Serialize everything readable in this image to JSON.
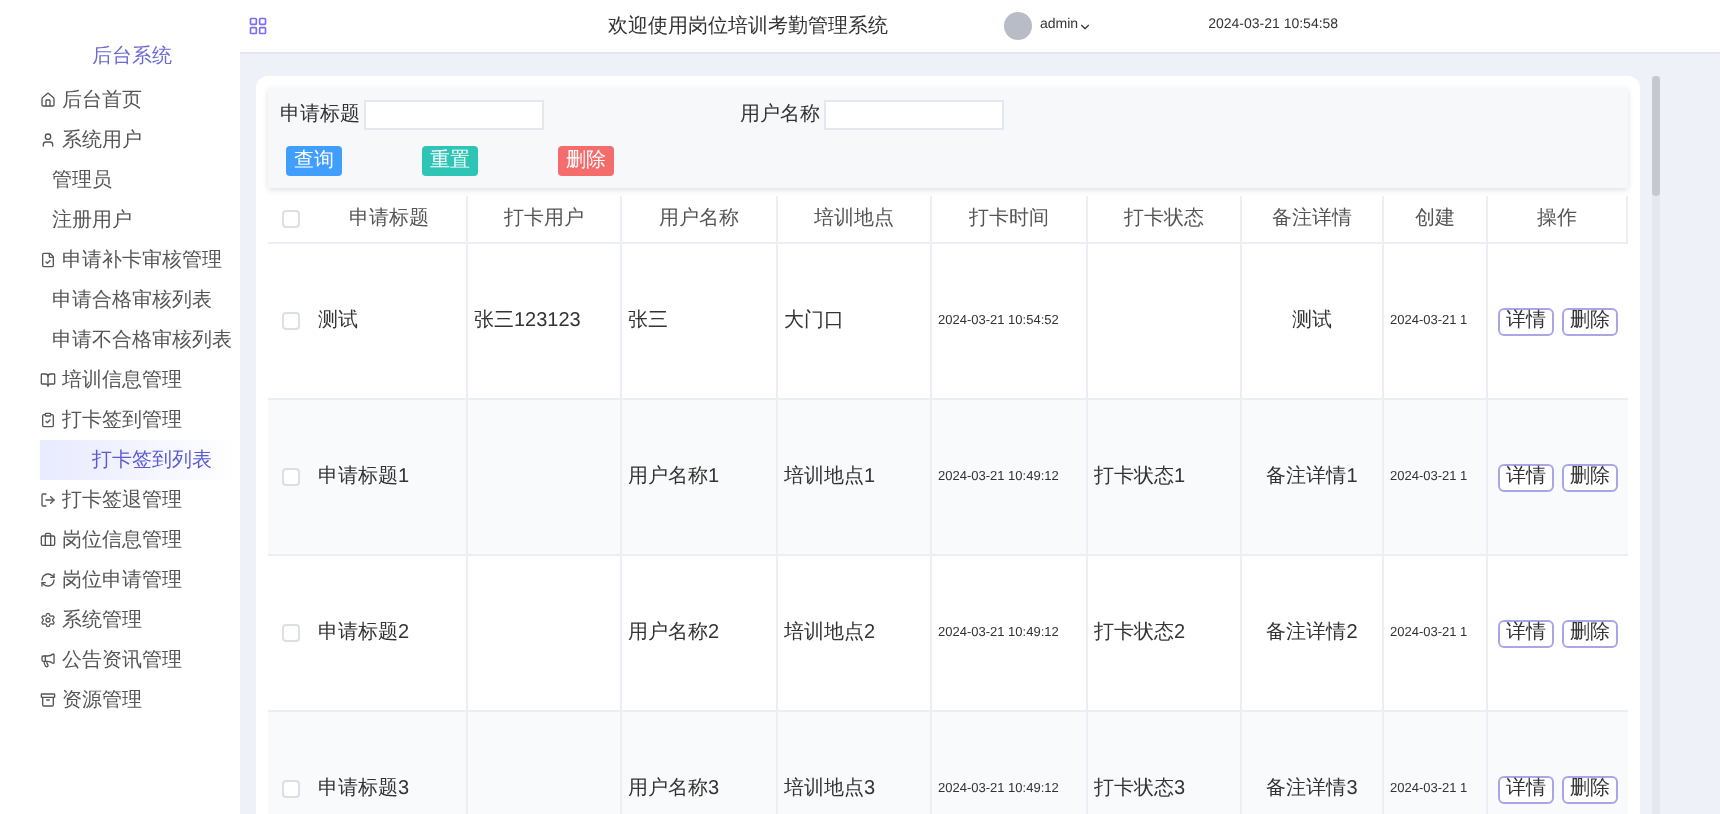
{
  "sidebar": {
    "title": "后台系统",
    "items": [
      {
        "label": "后台首页",
        "selected": false
      },
      {
        "label": "系统用户",
        "selected": false,
        "children": [
          {
            "label": "管理员",
            "selected": false
          },
          {
            "label": "注册用户",
            "selected": false
          }
        ]
      },
      {
        "label": "申请补卡审核管理",
        "selected": false,
        "children": [
          {
            "label": "申请合格审核列表",
            "selected": false
          },
          {
            "label": "申请不合格审核列表",
            "selected": false
          }
        ]
      },
      {
        "label": "培训信息管理",
        "selected": false
      },
      {
        "label": "打卡签到管理",
        "selected": false,
        "children": [
          {
            "label": "打卡签到列表",
            "selected": true
          }
        ]
      },
      {
        "label": "打卡签退管理",
        "selected": false
      },
      {
        "label": "岗位信息管理",
        "selected": false
      },
      {
        "label": "岗位申请管理",
        "selected": false
      },
      {
        "label": "系统管理",
        "selected": false
      },
      {
        "label": "公告资讯管理",
        "selected": false
      },
      {
        "label": "资源管理",
        "selected": false
      }
    ]
  },
  "header": {
    "title": "欢迎使用岗位培训考勤管理系统",
    "user": "admin",
    "datetime": "2024-03-21 10:54:58"
  },
  "search": {
    "fields": [
      {
        "label": "申请标题"
      },
      {
        "label": "用户名称"
      }
    ],
    "buttons": [
      {
        "label": "查询",
        "color": "#409eff"
      },
      {
        "label": "重置",
        "color": "#2ec4b6"
      },
      {
        "label": "删除",
        "color": "#f56c6c"
      }
    ]
  },
  "table": {
    "all_checked": false,
    "columns": [
      "申请标题",
      "打卡用户",
      "用户名称",
      "培训地点",
      "打卡时间",
      "打卡状态",
      "备注详情",
      "创建",
      "操作"
    ],
    "rows": [
      {
        "checked": false,
        "cells": [
          "测试",
          "张三123123",
          "张三",
          "大门口",
          "2024-03-21 10:54:52",
          "",
          "测试",
          "2024-03-21 1"
        ],
        "actions": [
          "详情",
          "删除"
        ]
      },
      {
        "checked": false,
        "cells": [
          "申请标题1",
          "",
          "用户名称1",
          "培训地点1",
          "2024-03-21 10:49:12",
          "打卡状态1",
          "备注详情1",
          "2024-03-21 1"
        ],
        "actions": [
          "详情",
          "删除"
        ]
      },
      {
        "checked": false,
        "cells": [
          "申请标题2",
          "",
          "用户名称2",
          "培训地点2",
          "2024-03-21 10:49:12",
          "打卡状态2",
          "备注详情2",
          "2024-03-21 1"
        ],
        "actions": [
          "详情",
          "删除"
        ]
      },
      {
        "checked": false,
        "cells": [
          "申请标题3",
          "",
          "用户名称3",
          "培训地点3",
          "2024-03-21 10:49:12",
          "打卡状态3",
          "备注详情3",
          "2024-03-21 1"
        ],
        "actions": [
          "详情",
          "删除"
        ]
      }
    ]
  }
}
